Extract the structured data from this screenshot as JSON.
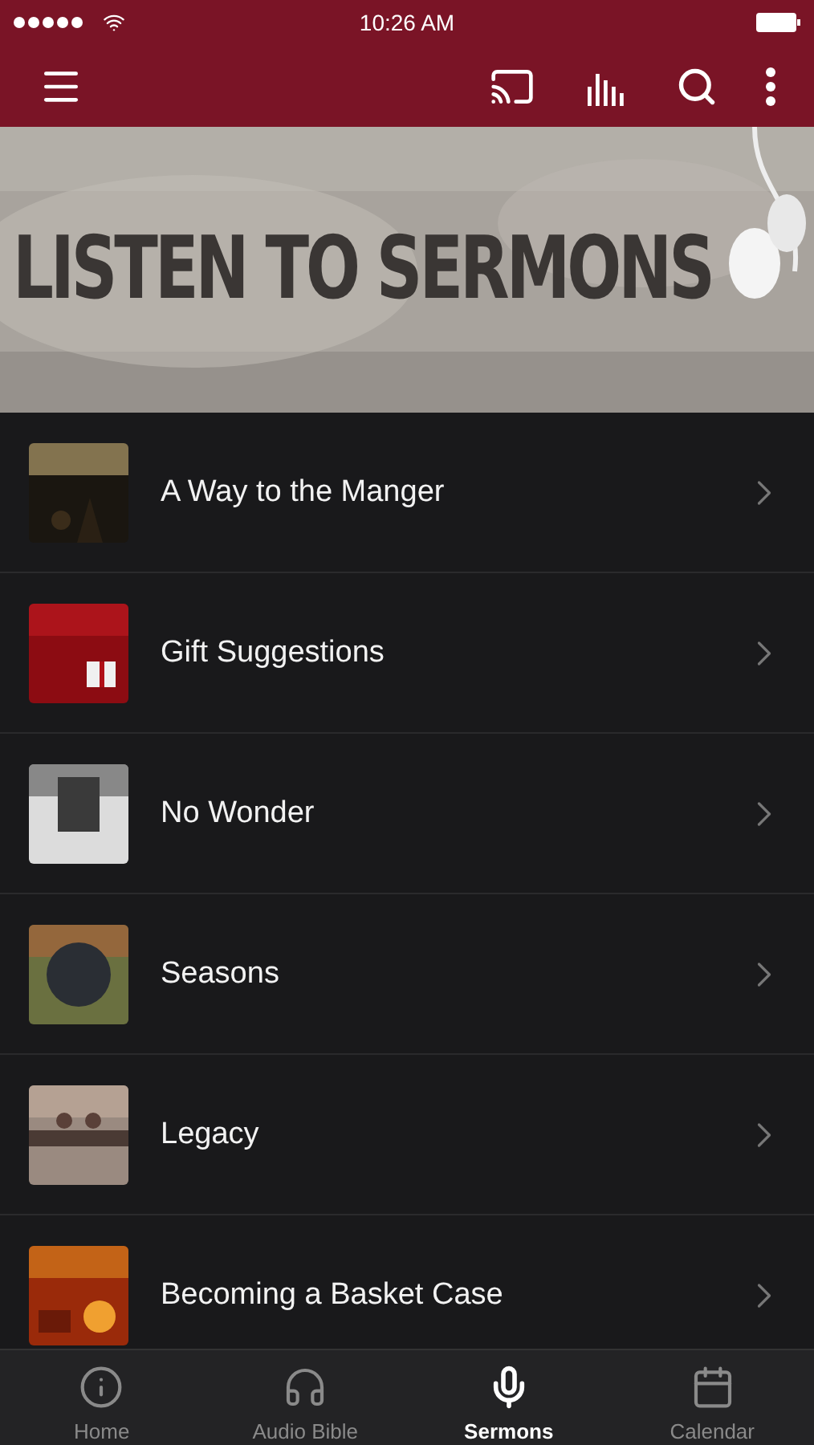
{
  "status_bar": {
    "time": "10:26 AM"
  },
  "banner": {
    "title": "LISTEN TO SERMONS"
  },
  "sermons": [
    {
      "title": "A Way to the Manger"
    },
    {
      "title": "Gift Suggestions"
    },
    {
      "title": "No Wonder"
    },
    {
      "title": "Seasons"
    },
    {
      "title": "Legacy"
    },
    {
      "title": "Becoming a Basket Case"
    }
  ],
  "tab_bar": [
    {
      "label": "Home",
      "selected": false
    },
    {
      "label": "Audio Bible",
      "selected": false
    },
    {
      "label": "Sermons",
      "selected": true
    },
    {
      "label": "Calendar",
      "selected": false
    }
  ]
}
